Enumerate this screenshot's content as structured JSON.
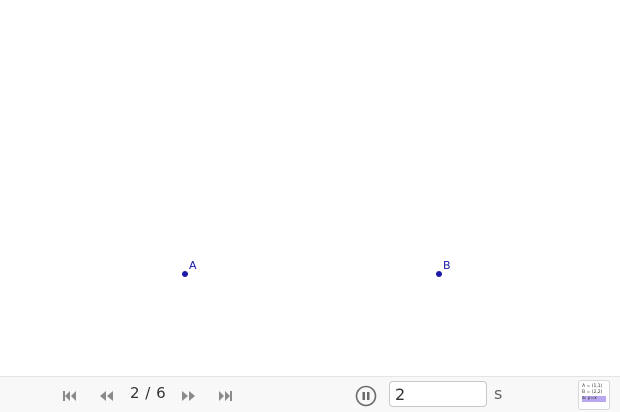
{
  "canvas": {
    "points": [
      {
        "label": "A",
        "x": 0,
        "y": 0
      },
      {
        "label": "B",
        "x": 1,
        "y": 0
      }
    ],
    "point_color": "#1a1aa6"
  },
  "navigation": {
    "step_counter": "2 / 6",
    "delay_value": "2",
    "delay_unit": "s",
    "buttons": [
      "skip-first-icon",
      "step-back-icon",
      "step-forward-icon",
      "skip-last-icon",
      "pause-icon"
    ],
    "algebra_view": {
      "line1": "A = (1,1)",
      "line2": "B = (2,2)",
      "line3": "a: y=x"
    }
  }
}
